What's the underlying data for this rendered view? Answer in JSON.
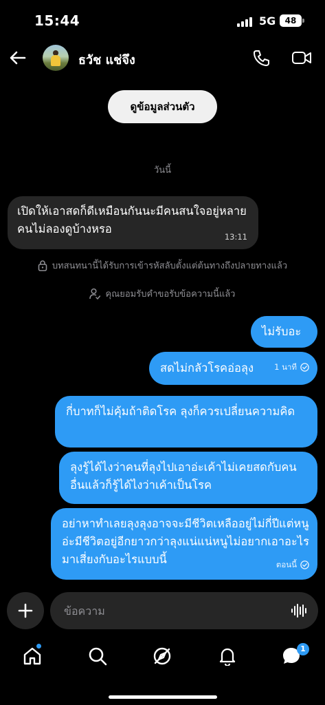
{
  "status_bar": {
    "time": "15:44",
    "network": "5G",
    "battery": "48"
  },
  "header": {
    "back_icon": "arrow-left-icon",
    "contact_name": "ธวัช แช่จึง",
    "call_icon": "phone-icon",
    "video_icon": "video-camera-icon"
  },
  "profile_button": {
    "label": "ดูข้อมูลส่วนตัว"
  },
  "day_label": "วันนี้",
  "incoming_messages": [
    {
      "text": "เปิดให้เอาสดก็ดีเหมือนกันนะมีคนสนใจอยู่หลายคนไม่ลองดูบ้างหรอ",
      "time": "13:11"
    }
  ],
  "system_notes": [
    {
      "icon": "lock-icon",
      "text": "บทสนทนานี้ได้รับการเข้ารหัสลับตั้งแต่ต้นทางถึงปลายทางแล้ว"
    },
    {
      "icon": "person-check-icon",
      "text": "คุณยอมรับคำขอรับข้อความนี้แล้ว"
    }
  ],
  "outgoing_messages": [
    {
      "text": "ไม่รับอะ",
      "time": ""
    },
    {
      "text": "สดไม่กลัวโรคอ่อลุง",
      "time": "1 นาที"
    },
    {
      "text": "กี่บาทก็ไม่คุ้มถ้าติดโรค ลุงก็ควรเปลี่ยนความคิด",
      "time": ""
    },
    {
      "text": "ลุงรู้ได้ไงว่าคนที่ลุงไปเอาอ่ะเค้าไม่เคยสดกับคนอื่นแล้วก็รู้ได้ไงว่าเค้าเป็นโรค",
      "time": ""
    },
    {
      "text": "อย่าหาทำเลยลุงลุงอาจจะมีชีวิตเหลืออยู่ไม่กี่ปีแต่หนูอ่ะมีชีวิตอยู่อีกยาวกว่าลุงแน่แน่หนูไม่อยากเอาอะไรมาเสี่ยงกับอะไรแบบนี้",
      "time": "ตอนนี้"
    }
  ],
  "composer": {
    "add_icon": "plus-icon",
    "placeholder": "ข้อความ",
    "voice_icon": "voice-wave-icon"
  },
  "bottom_nav": {
    "items": [
      {
        "icon": "home-icon"
      },
      {
        "icon": "search-icon"
      },
      {
        "icon": "explore-icon"
      },
      {
        "icon": "bell-icon"
      },
      {
        "icon": "chat-bubble-icon"
      }
    ],
    "messages_badge": "1"
  },
  "colors": {
    "background": "#000000",
    "outgoing_bubble": "#2e9bf5",
    "incoming_bubble": "#262626",
    "muted_text": "#8e8e93"
  }
}
